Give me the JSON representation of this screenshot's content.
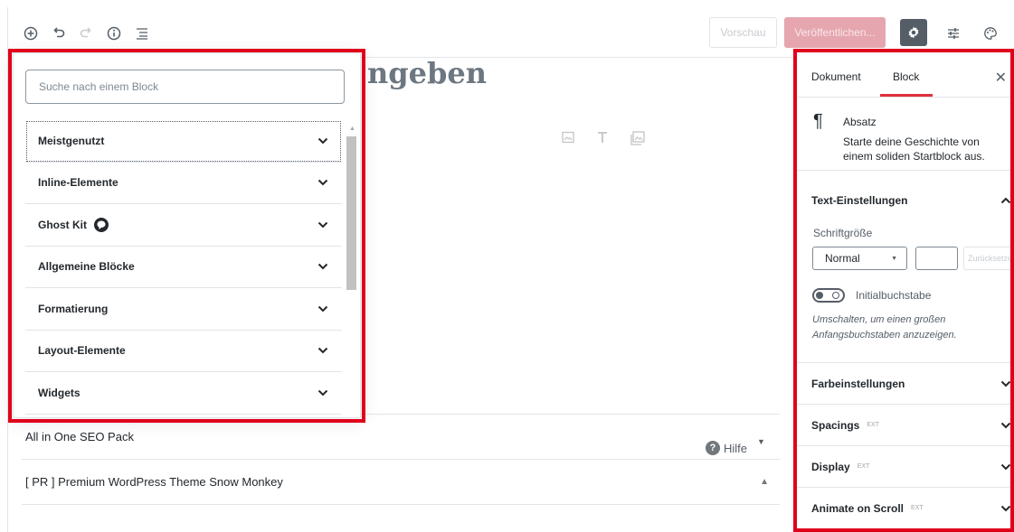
{
  "toolbar": {
    "icons": [
      "add-block-icon",
      "undo-icon",
      "redo-icon",
      "info-icon",
      "block-navigation-icon"
    ],
    "preview_label": "Vorschau",
    "publish_label": "Veröffentlichen...",
    "right_icons": [
      "gear-icon",
      "sliders-icon",
      "palette-icon"
    ]
  },
  "editor": {
    "title_fragment": "ngeben"
  },
  "inserter": {
    "search_placeholder": "Suche nach einem Block",
    "categories": [
      {
        "label": "Meistgenutzt"
      },
      {
        "label": "Inline-Elemente"
      },
      {
        "label": "Ghost Kit"
      },
      {
        "label": "Allgemeine Blöcke"
      },
      {
        "label": "Formatierung"
      },
      {
        "label": "Layout-Elemente"
      },
      {
        "label": "Widgets"
      }
    ]
  },
  "metaboxes": [
    {
      "title": "All in One SEO Pack"
    },
    {
      "title": "[ PR ] Premium WordPress Theme Snow Monkey"
    }
  ],
  "help_label": "Hilfe",
  "sidebar": {
    "tabs": [
      "Dokument",
      "Block"
    ],
    "active_tab": "Block",
    "block": {
      "name": "Absatz",
      "description": "Starte deine Geschichte von einem soliden Startblock aus."
    },
    "text_settings": {
      "title": "Text-Einstellungen",
      "font_size_label": "Schriftgröße",
      "font_size_value": "Normal",
      "reset_label": "Zurücksetzen",
      "drop_cap_label": "Initialbuchstabe",
      "drop_cap_help": "Umschalten, um einen großen Anfangsbuchstaben anzuzeigen."
    },
    "panels": [
      {
        "title": "Farbeinstellungen",
        "ext": ""
      },
      {
        "title": "Spacings",
        "ext": "EXT"
      },
      {
        "title": "Display",
        "ext": "EXT"
      },
      {
        "title": "Animate on Scroll",
        "ext": "EXT"
      }
    ]
  },
  "colors": {
    "highlight": "#e0001b",
    "tab_accent": "#e22f3c",
    "publish_bg": "#e5a6af"
  }
}
